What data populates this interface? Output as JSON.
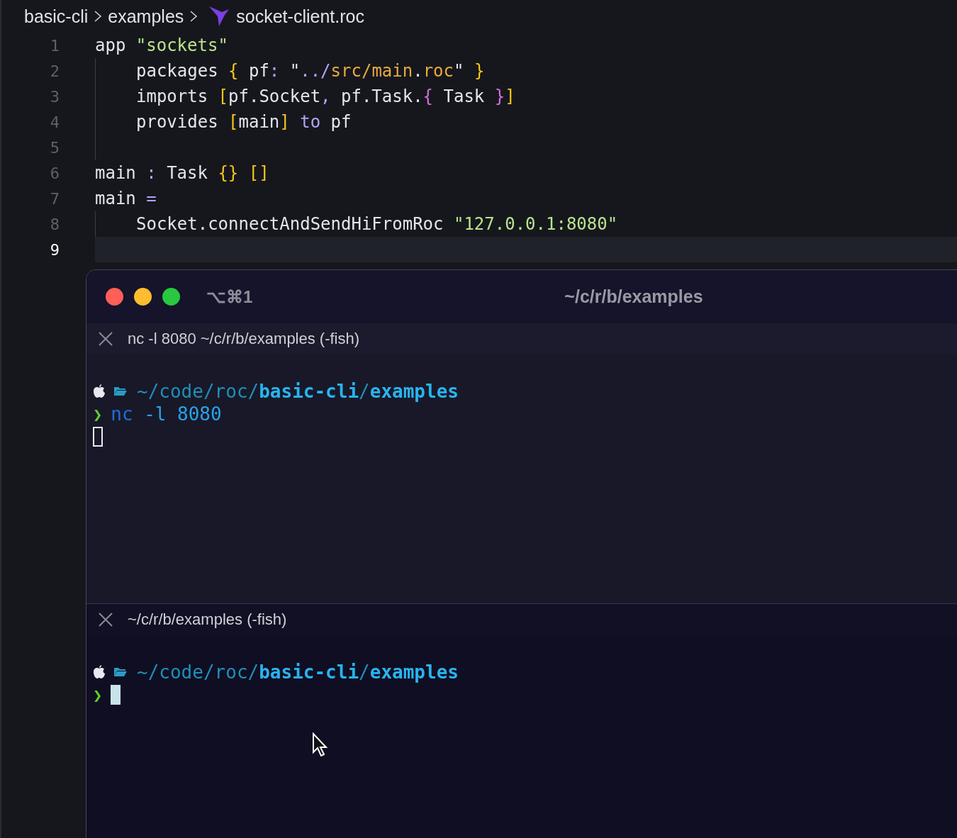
{
  "breadcrumb": [
    {
      "label": "basic-cli"
    },
    {
      "label": "examples"
    },
    {
      "label": "socket-client.roc"
    }
  ],
  "editor": {
    "lines": [
      {
        "number": "1",
        "current": false,
        "indented": false,
        "tokens": [
          {
            "text": "app ",
            "kind": "plain"
          },
          {
            "text": "\"sockets\"",
            "kind": "string"
          }
        ]
      },
      {
        "number": "2",
        "current": false,
        "indented": true,
        "tokens": [
          {
            "text": "packages ",
            "kind": "plain"
          },
          {
            "text": "{",
            "kind": "bracket"
          },
          {
            "text": " pf",
            "kind": "plain"
          },
          {
            "text": ":",
            "kind": "operator"
          },
          {
            "text": " \"",
            "kind": "plain"
          },
          {
            "text": "../",
            "kind": "operator"
          },
          {
            "text": "src/main",
            "kind": "path"
          },
          {
            "text": ".",
            "kind": "plain"
          },
          {
            "text": "roc",
            "kind": "path"
          },
          {
            "text": "\" ",
            "kind": "plain"
          },
          {
            "text": "}",
            "kind": "bracket"
          }
        ]
      },
      {
        "number": "3",
        "current": false,
        "indented": true,
        "tokens": [
          {
            "text": "imports ",
            "kind": "plain"
          },
          {
            "text": "[",
            "kind": "bracket"
          },
          {
            "text": "pf.Socket",
            "kind": "plain"
          },
          {
            "text": ",",
            "kind": "operator"
          },
          {
            "text": " pf.Task.",
            "kind": "plain"
          },
          {
            "text": "{",
            "kind": "brace"
          },
          {
            "text": " Task ",
            "kind": "plain"
          },
          {
            "text": "}",
            "kind": "brace"
          },
          {
            "text": "]",
            "kind": "bracket"
          }
        ]
      },
      {
        "number": "4",
        "current": false,
        "indented": true,
        "tokens": [
          {
            "text": "provides ",
            "kind": "plain"
          },
          {
            "text": "[",
            "kind": "bracket"
          },
          {
            "text": "main",
            "kind": "plain"
          },
          {
            "text": "]",
            "kind": "bracket"
          },
          {
            "text": " to",
            "kind": "operator"
          },
          {
            "text": " pf",
            "kind": "plain"
          }
        ]
      },
      {
        "number": "5",
        "current": false,
        "indented": true
      },
      {
        "number": "6",
        "current": false,
        "indented": false,
        "tokens": [
          {
            "text": "main ",
            "kind": "plain"
          },
          {
            "text": ":",
            "kind": "operator"
          },
          {
            "text": " Task ",
            "kind": "plain"
          },
          {
            "text": "{} []",
            "kind": "bracket"
          }
        ]
      },
      {
        "number": "7",
        "current": false,
        "indented": false,
        "tokens": [
          {
            "text": "main ",
            "kind": "plain"
          },
          {
            "text": "=",
            "kind": "operator"
          }
        ]
      },
      {
        "number": "8",
        "current": false,
        "indented": true,
        "tokens": [
          {
            "text": "Socket.connectAndSendHiFromRoc ",
            "kind": "plain"
          },
          {
            "text": "\"127.0.0.1:8080\"",
            "kind": "string"
          }
        ]
      },
      {
        "number": "9",
        "current": true,
        "indented": false
      }
    ]
  },
  "terminal": {
    "shortcut": "⌥⌘1",
    "title": "~/c/r/b/examples",
    "panes": [
      {
        "tab_title": "nc -l 8080 ~/c/r/b/examples (-fish)",
        "focused": false,
        "path": [
          {
            "text": "~/code/roc/",
            "highlight": false
          },
          {
            "text": "basic-cli",
            "highlight": true
          },
          {
            "text": "/",
            "highlight": false
          },
          {
            "text": "examples",
            "highlight": true
          }
        ],
        "prompt": "❯",
        "command": [
          {
            "text": "nc",
            "kind": "command"
          },
          {
            "text": "-l",
            "kind": "argument"
          },
          {
            "text": "8080",
            "kind": "argument"
          }
        ]
      },
      {
        "tab_title": "~/c/r/b/examples (-fish)",
        "focused": true,
        "path": [
          {
            "text": "~/code/roc/",
            "highlight": false
          },
          {
            "text": "basic-cli",
            "highlight": true
          },
          {
            "text": "/",
            "highlight": false
          },
          {
            "text": "examples",
            "highlight": true
          }
        ],
        "prompt": "❯"
      }
    ]
  }
}
